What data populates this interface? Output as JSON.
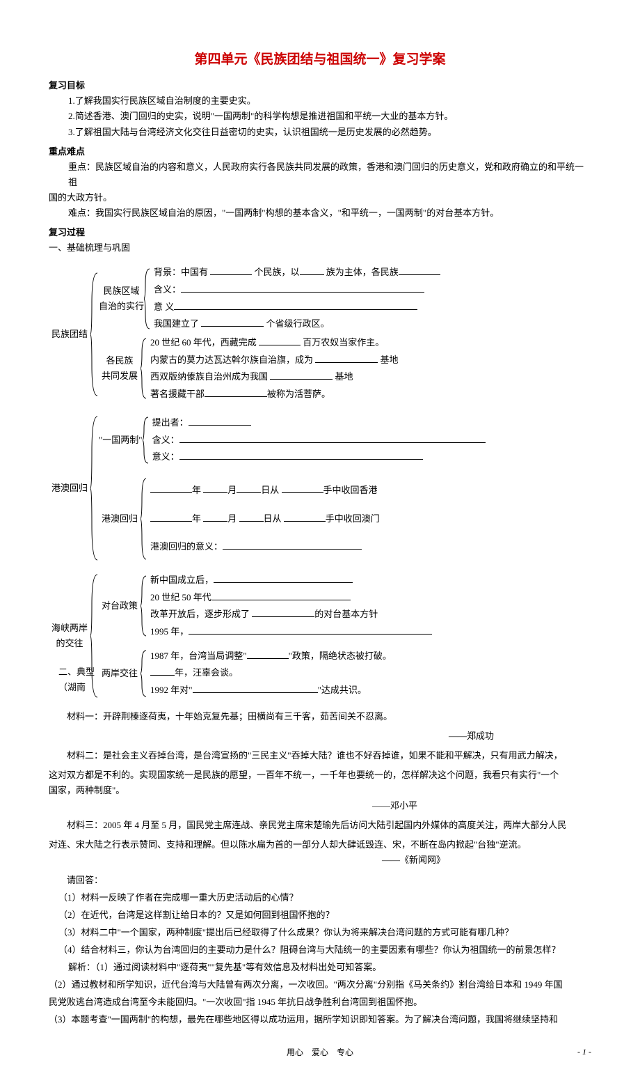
{
  "title": "第四单元《民族团结与祖国统一》复习学案",
  "sections": {
    "goals_head": "复习目标",
    "goal1": "1.了解我国实行民族区域自治制度的主要史实。",
    "goal2": "2.简述香港、澳门回归的史实，说明\"一国两制\"的科学构想是推进祖国和平统一大业的基本方针。",
    "goal3": "3.了解祖国大陆与台湾经济文化交往日益密切的史实，认识祖国统一是历史发展的必然趋势。",
    "diff_head": "重点难点",
    "diff1a": "重点：民族区域自治的内容和意义，人民政府实行各民族共同发展的政策，香港和澳门回归的历史意义，党和政府确立的和平统一祖",
    "diff1b": "国的大政方针。",
    "diff2": "难点：我国实行民族区域自治的原因，\"一国两制\"构想的基本含义，\"和平统一，一国两制\"的对台基本方针。",
    "proc_head": "复习过程",
    "proc_sub1": "一、基础梳理与巩固"
  },
  "tree": {
    "node1": "民族团结",
    "node1a": "民族区域",
    "node1a2": "自治的实行",
    "node1a_l1_a": "背景：中国有",
    "node1a_l1_b": "个民族，以",
    "node1a_l1_c": "族为主体，各民族",
    "node1a_l2": "含义：",
    "node1a_l3": "意 义",
    "node1a_l4_a": "我国建立了",
    "node1a_l4_b": "个省级行政区。",
    "node1b": "各民族",
    "node1b2": "共同发展",
    "node1b_l1_a": "20 世纪 60 年代，西藏完成",
    "node1b_l1_b": "百万农奴当家作主。",
    "node1b_l2_a": "内蒙古的莫力达瓦达斡尔族自治旗，成为",
    "node1b_l2_b": "基地",
    "node1b_l3_a": "西双版纳傣族自治州成为我国",
    "node1b_l3_b": "基地",
    "node1b_l4_a": "著名援藏干部",
    "node1b_l4_b": "被称为活菩萨。",
    "node2": "港澳回归",
    "node2a": "\"一国两制\"",
    "node2a_l1": "提出者：",
    "node2a_l2": "含义：",
    "node2a_l3": "意义：",
    "node2b": "港澳回归",
    "node2b_l1_suffix": "手中收回香港",
    "node2b_l2_suffix": "手中收回澳门",
    "node2b_l3": "港澳回归的意义：",
    "date_y": "年",
    "date_m": "月",
    "date_d": "日从",
    "node3": "海峡两岸",
    "node3_2": "的交往",
    "node3a": "对台政策",
    "node3a_l1": "新中国成立后，",
    "node3a_l2": "20 世纪 50 年代",
    "node3a_l3_a": "改革开放后，逐步形成了",
    "node3a_l3_b": "的对台基本方针",
    "node3a_l4": "1995 年，",
    "node3b": "两岸交往",
    "node3b_l1_a": "1987 年，台湾当局调整\"",
    "node3b_l1_b": "\"政策，隔绝状态被打破。",
    "node3b_l2": "年，汪辜会谈。",
    "node3b_l3_a": "1992 年对\"",
    "node3b_l3_b": "\"达成共识。",
    "sub2_a": "二、典型",
    "sub2_b": "（湖南"
  },
  "materials": {
    "m1": "材料一：开辟荆榛逐荷夷，十年始克复先基；田横尚有三千客，茹苦间关不忍离。",
    "m1_src": "——郑成功",
    "m2a": "材料二：是社会主义吞掉台湾，是台湾宣扬的\"三民主义\"吞掉大陆？谁也不好吞掉谁，如果不能和平解决，只有用武力解决，",
    "m2b": "这对双方都是不利的。实现国家统一是民族的愿望，一百年不统一，一千年也要统一的，怎样解决这个问题，我看只有实行\"一个",
    "m2c": "国家，两种制度\"。",
    "m2_src": "——邓小平",
    "m3a": "材料三：2005 年 4 月至 5 月，国民党主席连战、亲民党主席宋楚瑜先后访问大陆引起国内外媒体的高度关注，两岸大部分人民",
    "m3b": "对连、宋大陆之行表示赞同、支持和理解。但以陈水扁为首的一部分人却大肆诋毁连、宋，不断在岛内掀起\"台独\"逆流。",
    "m3_src": "——《新闻网》",
    "qhead": "请回答：",
    "q1": "（1）材料一反映了作者在完成哪一重大历史活动后的心情？",
    "q2": "（2）在近代，台湾是这样割让给日本的？又是如何回到祖国怀抱的？",
    "q3": "（3）材料二中\"一个国家，两种制度\"提出后已经取得了什么成果？你认为将来解决台湾问题的方式可能有哪几种？",
    "q4": "（4）结合材料三，你认为台湾回归的主要动力是什么？阻碍台湾与大陆统一的主要因素有哪些？你认为祖国统一的前景怎样？",
    "a1": "解析：（1）通过阅读材料中\"逐荷夷\"\"复先基\"等有效信息及材料出处可知答案。",
    "a2a": "（2）通过教材和所学知识，近代台湾与大陆曾有两次分离，一次收回。\"两次分离\"分别指《马关条约》割台湾给日本和 1949 年国",
    "a2b": "民党败逃台湾造成台湾至今未能回归。\"一次收回\"指 1945 年抗日战争胜利台湾回到祖国怀抱。",
    "a3": "（3）本题考查\"一国两制\"的构想，最先在哪些地区得以成功运用，据所学知识即知答案。为了解决台湾问题，我国将继续坚持和"
  },
  "footer": {
    "center": "用心　爱心　专心",
    "page": "- 1 -"
  }
}
